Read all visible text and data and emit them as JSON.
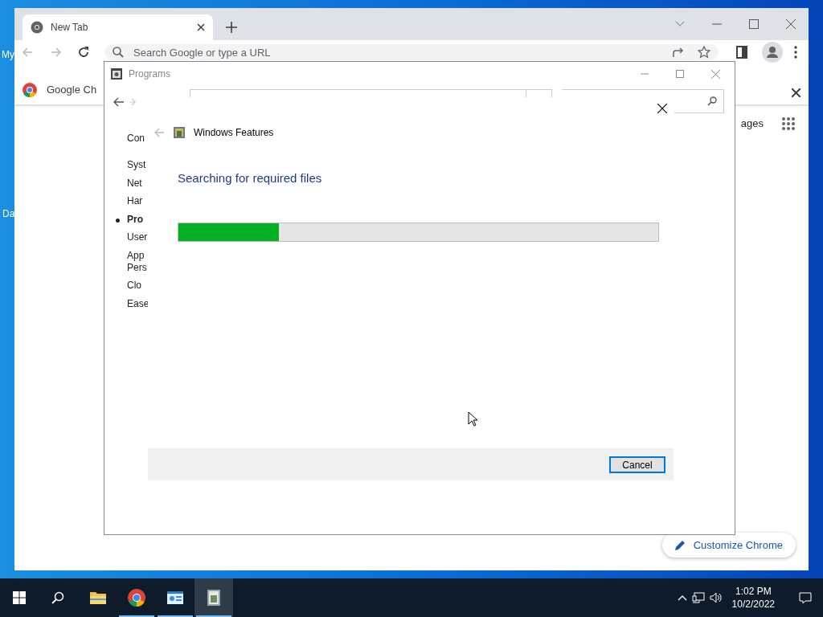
{
  "desktop": {
    "icon_labels": [
      "My",
      "Da"
    ]
  },
  "browser": {
    "tabs": [
      {
        "label": "New Tab",
        "selected": true
      }
    ],
    "omnibox": {
      "placeholder": "Search Google or type a URL"
    },
    "banner": {
      "text": "Google Ch"
    },
    "page": {
      "link_fragment": "ages",
      "customize_button": "Customize Chrome"
    }
  },
  "programs_window": {
    "title": "Programs",
    "sidebar_heading": "Con",
    "sidebar": [
      {
        "label": "Syst",
        "selected": false
      },
      {
        "label": "Net",
        "selected": false
      },
      {
        "label": "Har",
        "selected": false
      },
      {
        "label": "Pro",
        "selected": true
      },
      {
        "label": "User",
        "selected": false
      },
      {
        "label": "App\nPers",
        "selected": false
      },
      {
        "label": "Clo",
        "selected": false
      },
      {
        "label": "Ease",
        "selected": false
      }
    ]
  },
  "dialog": {
    "title": "Windows Features",
    "heading": "Searching for required files",
    "progress": {
      "level": 0.21
    },
    "buttons": [
      {
        "label": "Cancel",
        "default": true
      }
    ]
  },
  "taskbar": {
    "apps": [
      {
        "kind": "explorer",
        "running": false,
        "active": false
      },
      {
        "kind": "chrome",
        "running": true,
        "active": false
      },
      {
        "kind": "control-panel",
        "running": true,
        "active": false
      },
      {
        "kind": "installer",
        "running": true,
        "active": true
      }
    ],
    "clock": {
      "time": "1:02 PM",
      "date": "10/2/2022"
    }
  }
}
